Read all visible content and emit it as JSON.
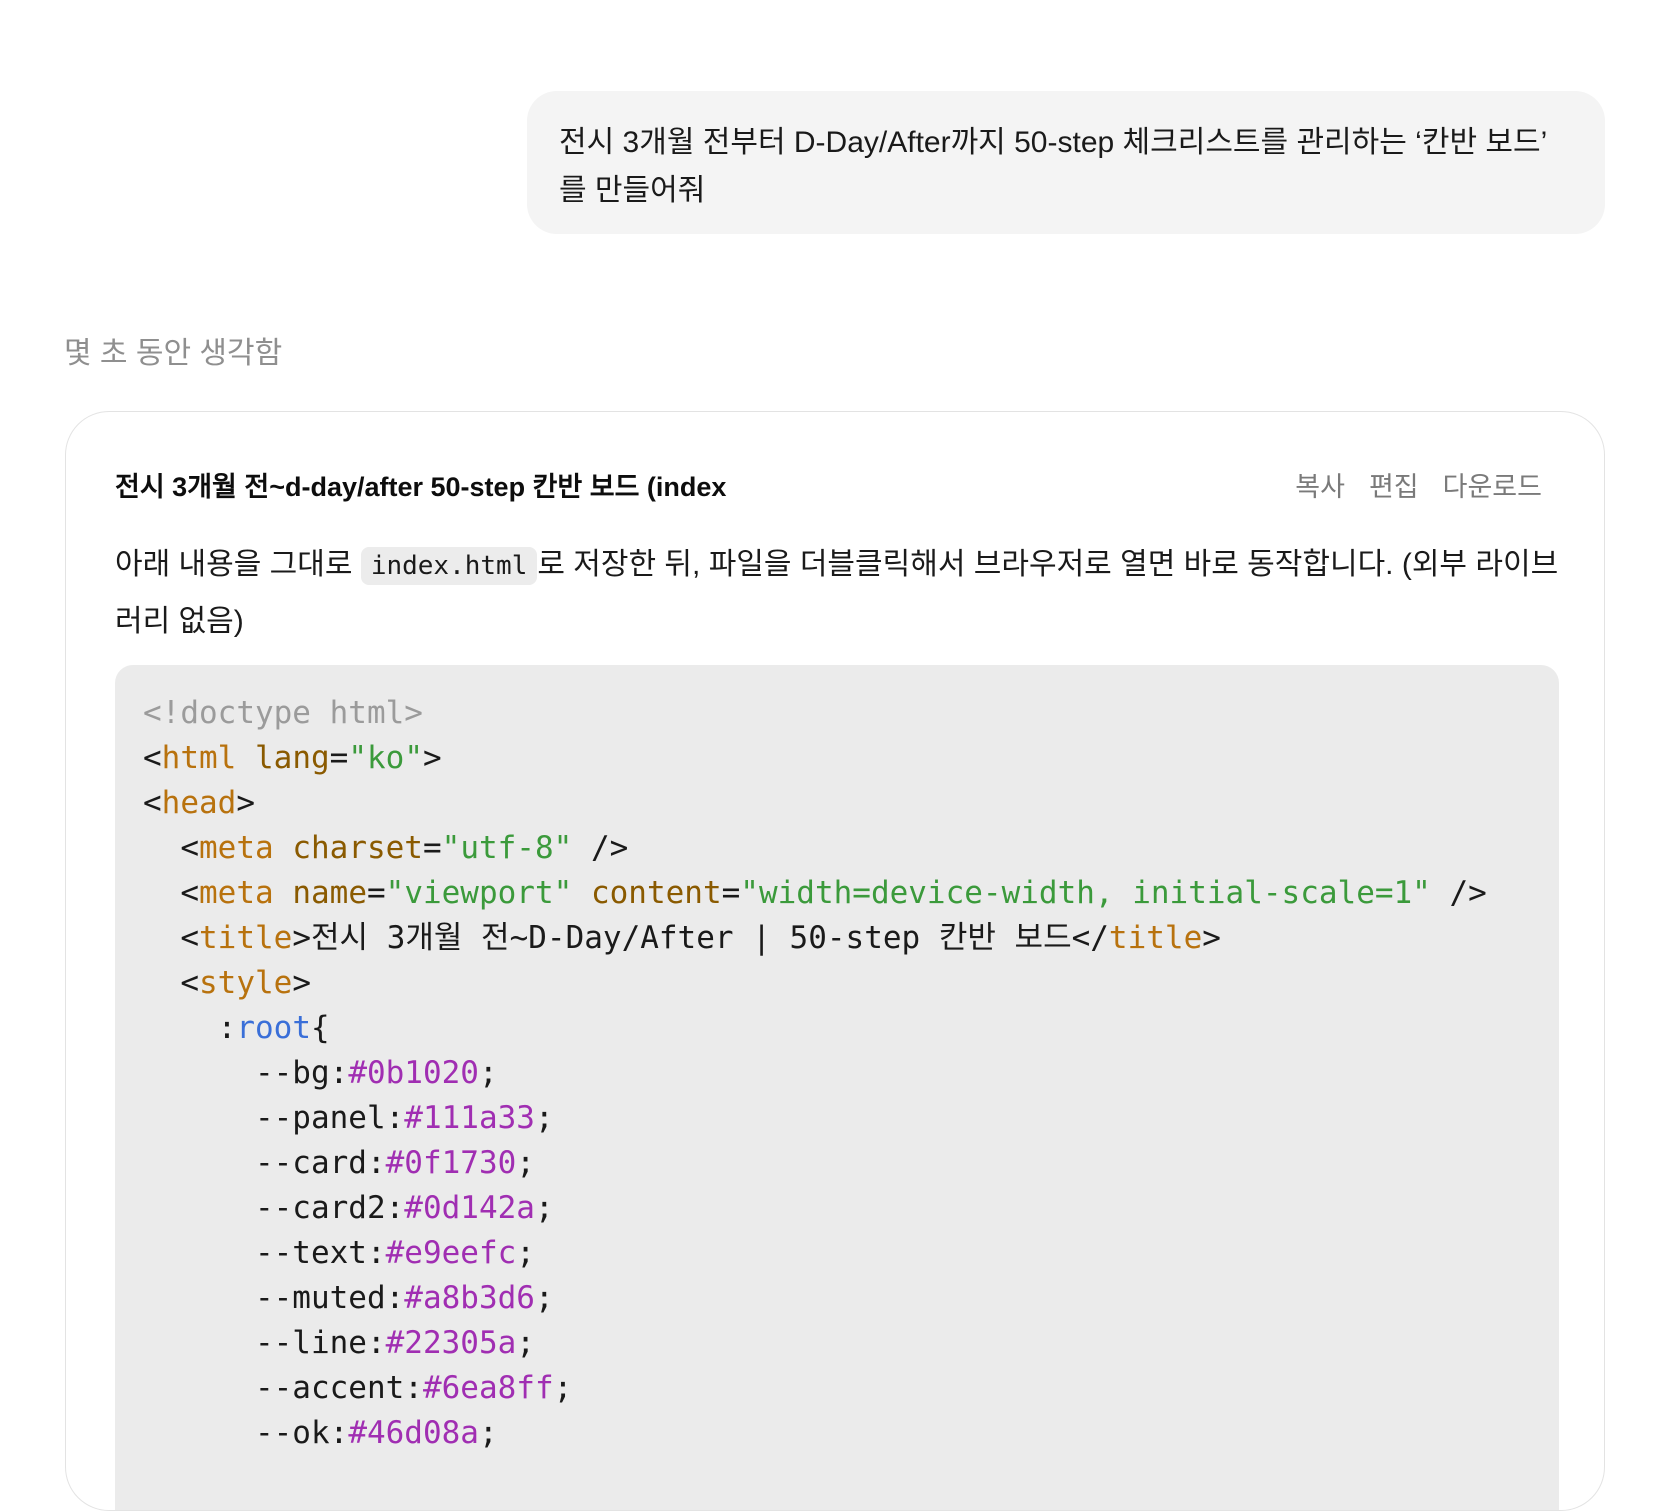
{
  "user_message": {
    "text": "전시 3개월 전부터 D-Day/After까지 50-step 체크리스트를 관리하는 ‘칸반 보드’ 를 만들어줘"
  },
  "assistant": {
    "thinking_label": "몇 초 동안 생각함",
    "canvas": {
      "title": "전시 3개월 전~d-day/after 50-step 칸반 보드 (index",
      "actions": {
        "copy": "복사",
        "edit": "편집",
        "download": "다운로드"
      },
      "intro_before": "아래 내용을 그대로 ",
      "intro_code": "index.html",
      "intro_after": "로 저장한 뒤, 파일을 더블클릭해서 브라우저로 열면 바로 동작합니다. (외부 라이브러리 없음)",
      "code_lines": [
        [
          {
            "t": "<!doctype html>",
            "c": "comment"
          }
        ],
        [
          {
            "t": "<",
            "c": "punc"
          },
          {
            "t": "html",
            "c": "tag"
          },
          {
            "t": " ",
            "c": "punc"
          },
          {
            "t": "lang",
            "c": "attr"
          },
          {
            "t": "=",
            "c": "punc"
          },
          {
            "t": "\"ko\"",
            "c": "str"
          },
          {
            "t": ">",
            "c": "punc"
          }
        ],
        [
          {
            "t": "<",
            "c": "punc"
          },
          {
            "t": "head",
            "c": "tag"
          },
          {
            "t": ">",
            "c": "punc"
          }
        ],
        [
          {
            "t": "  <",
            "c": "punc"
          },
          {
            "t": "meta",
            "c": "tag"
          },
          {
            "t": " ",
            "c": "punc"
          },
          {
            "t": "charset",
            "c": "attr"
          },
          {
            "t": "=",
            "c": "punc"
          },
          {
            "t": "\"utf-8\"",
            "c": "str"
          },
          {
            "t": " />",
            "c": "punc"
          }
        ],
        [
          {
            "t": "  <",
            "c": "punc"
          },
          {
            "t": "meta",
            "c": "tag"
          },
          {
            "t": " ",
            "c": "punc"
          },
          {
            "t": "name",
            "c": "attr"
          },
          {
            "t": "=",
            "c": "punc"
          },
          {
            "t": "\"viewport\"",
            "c": "str"
          },
          {
            "t": " ",
            "c": "punc"
          },
          {
            "t": "content",
            "c": "attr"
          },
          {
            "t": "=",
            "c": "punc"
          },
          {
            "t": "\"width=device-width, initial-scale=1\"",
            "c": "str"
          },
          {
            "t": " />",
            "c": "punc"
          }
        ],
        [
          {
            "t": "  <",
            "c": "punc"
          },
          {
            "t": "title",
            "c": "tag"
          },
          {
            "t": ">전시 3개월 전~D-Day/After | 50-step 칸반 보드</",
            "c": "punc"
          },
          {
            "t": "title",
            "c": "tag"
          },
          {
            "t": ">",
            "c": "punc"
          }
        ],
        [
          {
            "t": "  <",
            "c": "punc"
          },
          {
            "t": "style",
            "c": "tag"
          },
          {
            "t": ">",
            "c": "punc"
          }
        ],
        [
          {
            "t": "    :",
            "c": "punc"
          },
          {
            "t": "root",
            "c": "sel"
          },
          {
            "t": "{",
            "c": "punc"
          }
        ],
        [
          {
            "t": "      --bg:",
            "c": "punc"
          },
          {
            "t": "#0b1020",
            "c": "hex"
          },
          {
            "t": ";",
            "c": "punc"
          }
        ],
        [
          {
            "t": "      --panel:",
            "c": "punc"
          },
          {
            "t": "#111a33",
            "c": "hex"
          },
          {
            "t": ";",
            "c": "punc"
          }
        ],
        [
          {
            "t": "      --card:",
            "c": "punc"
          },
          {
            "t": "#0f1730",
            "c": "hex"
          },
          {
            "t": ";",
            "c": "punc"
          }
        ],
        [
          {
            "t": "      --card2:",
            "c": "punc"
          },
          {
            "t": "#0d142a",
            "c": "hex"
          },
          {
            "t": ";",
            "c": "punc"
          }
        ],
        [
          {
            "t": "      --text:",
            "c": "punc"
          },
          {
            "t": "#e9eefc",
            "c": "hex"
          },
          {
            "t": ";",
            "c": "punc"
          }
        ],
        [
          {
            "t": "      --muted:",
            "c": "punc"
          },
          {
            "t": "#a8b3d6",
            "c": "hex"
          },
          {
            "t": ";",
            "c": "punc"
          }
        ],
        [
          {
            "t": "      --line:",
            "c": "punc"
          },
          {
            "t": "#22305a",
            "c": "hex"
          },
          {
            "t": ";",
            "c": "punc"
          }
        ],
        [
          {
            "t": "      --accent:",
            "c": "punc"
          },
          {
            "t": "#6ea8ff",
            "c": "hex"
          },
          {
            "t": ";",
            "c": "punc"
          }
        ],
        [
          {
            "t": "      --ok:",
            "c": "punc"
          },
          {
            "t": "#46d08a",
            "c": "hex"
          },
          {
            "t": ";",
            "c": "punc"
          }
        ]
      ]
    }
  }
}
